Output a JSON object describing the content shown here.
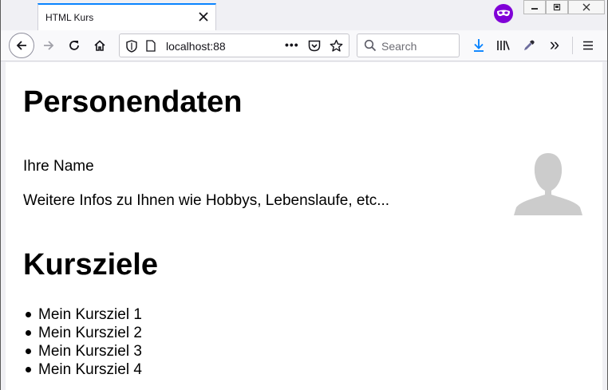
{
  "browser": {
    "tab_title": "HTML Kurs",
    "tab_close_glyph": "✕",
    "url": "localhost:88",
    "search_placeholder": "Search",
    "page_actions_glyph": "•••",
    "overflow_glyph": "»",
    "accent_color": "#0a84ff",
    "private_color": "#8000d7",
    "icons": [
      "back-icon",
      "forward-icon",
      "reload-icon",
      "home-icon",
      "shield-icon",
      "page-icon",
      "pocket-icon",
      "bookmark-star-icon",
      "search-icon",
      "download-icon",
      "library-icon",
      "eyedropper-icon",
      "menu-icon",
      "private-mask-icon",
      "minimize-icon",
      "restore-icon",
      "close-icon"
    ]
  },
  "page": {
    "heading_personal": "Personendaten",
    "name_text": "Ihre Name",
    "info_text": "Weitere Infos zu Ihnen wie Hobbys, Lebenslaufe, etc...",
    "heading_goals": "Kursziele",
    "goals": [
      "Mein Kursziel 1",
      "Mein Kursziel 2",
      "Mein Kursziel 3",
      "Mein Kursziel 4"
    ]
  }
}
